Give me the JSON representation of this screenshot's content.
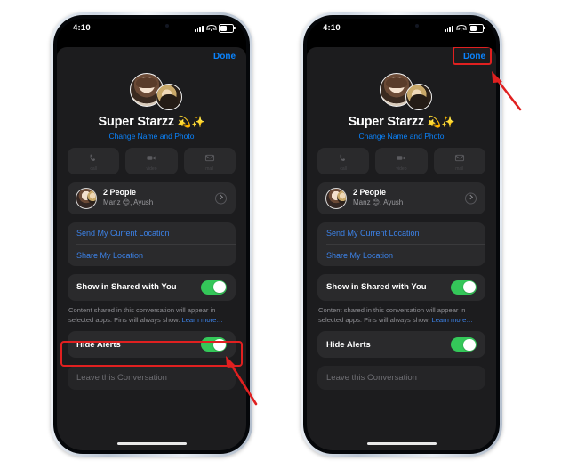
{
  "status_bar": {
    "time": "4:10",
    "signal_icon": "cellular-bars-icon",
    "wifi_icon": "wifi-icon",
    "battery_icon": "battery-icon"
  },
  "nav": {
    "done_label": "Done"
  },
  "group": {
    "title": "Super Starzz",
    "title_emoji": "💫✨",
    "subtitle": "Change Name and Photo"
  },
  "actions": [
    {
      "label": "call",
      "icon": "phone-icon"
    },
    {
      "label": "video",
      "icon": "video-camera-icon"
    },
    {
      "label": "mail",
      "icon": "envelope-icon"
    }
  ],
  "people": {
    "count_label": "2 People",
    "names": "Manz 😊, Ayush",
    "chevron_icon": "chevron-right-circle-icon"
  },
  "location": {
    "send_current": "Send My Current Location",
    "share": "Share My Location"
  },
  "shared_with_you": {
    "label": "Show in Shared with You",
    "toggle_on": true,
    "note_text": "Content shared in this conversation will appear in selected apps. Pins will always show.",
    "note_link": "Learn more…"
  },
  "hide_alerts": {
    "label": "Hide Alerts",
    "toggle_on": true
  },
  "leave": {
    "label": "Leave this Conversation"
  },
  "annotations": {
    "highlight_color": "#e02020",
    "left_target": "Hide Alerts",
    "right_target": "Done"
  },
  "colors": {
    "accent_blue": "#0a84ff",
    "link_blue": "#3c82e8",
    "toggle_green": "#34c759",
    "sheet_bg": "#1c1c1e",
    "card_bg": "#2a2a2c"
  }
}
